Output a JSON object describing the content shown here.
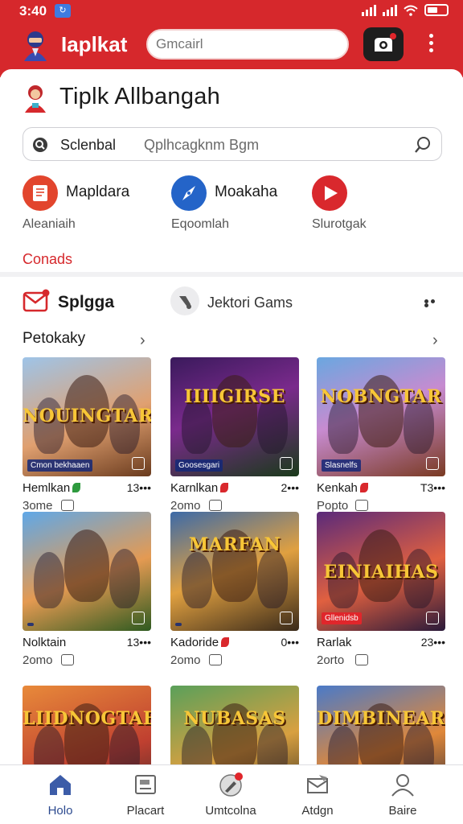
{
  "status_bar": {
    "time": "3:40",
    "notification_icon": "sync-icon"
  },
  "header": {
    "app_title": "Iaplkat",
    "search_placeholder": "Gmcairl",
    "colors": {
      "brand_red": "#d6282c"
    }
  },
  "section": {
    "title": "Tiplk Allbangah",
    "search": {
      "label": "Sclenbal",
      "placeholder": "Qplhcagknm Bgm"
    },
    "quick_actions": [
      {
        "title": "Mapldara",
        "subtitle": "Aleaniaih",
        "icon": "book-icon",
        "color": "#e2452d"
      },
      {
        "title": "Moakaha",
        "subtitle": "Eqoomlah",
        "icon": "compass-icon",
        "color": "#2464c8"
      },
      {
        "title": "",
        "subtitle": "Slurotgak",
        "icon": "play-icon",
        "color": "#d9282d"
      }
    ],
    "link_text": "Conads"
  },
  "games": {
    "tab1_label": "Splgga",
    "tab2_label": "Jektori Gams",
    "category_label": "Petokaky",
    "tiles": [
      {
        "art_title": "NOUINGTAR",
        "strip": "Cmon bekhaaen",
        "name": "Hemlkan",
        "badge_color": "#2e9a3e",
        "count": "13•••",
        "sub": "3ome",
        "bg": "linear-gradient(160deg,#9ec4e8 0%,#e0a070 55%,#6a3b1e 100%)"
      },
      {
        "art_title": "IIIIGIRSE",
        "strip": "Goosesgari",
        "name": "Karnlkan",
        "badge_color": "#d9282d",
        "count": "2•••",
        "sub": "2omo",
        "bg": "linear-gradient(160deg,#3a1a5c 0%,#7a2a8c 45%,#1a3a1a 100%)"
      },
      {
        "art_title": "NOBNGTAR",
        "strip": "Slasnelfs",
        "name": "Kenkah",
        "badge_color": "#d9282d",
        "count": "T3•••",
        "sub": "Popto",
        "bg": "linear-gradient(160deg,#6aa7e0 0%,#c78bd0 45%,#7a3a22 100%)"
      },
      {
        "art_title": "",
        "strip": "",
        "name": "Nolktain",
        "badge_color": "",
        "count": "13•••",
        "sub": "2omo",
        "bg": "linear-gradient(160deg,#5fa8e8 0%,#e49a52 55%,#2e5a20 100%)"
      },
      {
        "art_title": "MARFAN",
        "strip": "",
        "name": "Kadoride",
        "badge_color": "#d9282d",
        "count": "0•••",
        "sub": "2omo",
        "bg": "linear-gradient(160deg,#3c6aa8 0%,#e0a040 50%,#3a2a1a 100%)"
      },
      {
        "art_title": "EINIAIHAS",
        "strip": "Gllenidsb",
        "name": "Rarlak",
        "badge_color": "",
        "count": "23•••",
        "sub": "2orto",
        "bg": "linear-gradient(160deg,#5a2a7a 0%,#e06040 55%,#2a1a3a 100%)"
      },
      {
        "art_title": "LIIDNOGTAE",
        "strip": "",
        "name": "",
        "badge_color": "",
        "count": "",
        "sub": "",
        "bg": "linear-gradient(160deg,#e88a3a 0%,#c04030 60%,#4a2a2a 100%)"
      },
      {
        "art_title": "NUBASAS",
        "strip": "",
        "name": "",
        "badge_color": "",
        "count": "",
        "sub": "",
        "bg": "linear-gradient(160deg,#5aa05a 0%,#d8a040 55%,#3a3020 100%)"
      },
      {
        "art_title": "DIMBINEAR",
        "strip": "",
        "name": "",
        "badge_color": "",
        "count": "",
        "sub": "",
        "bg": "linear-gradient(160deg,#4a7ac8 0%,#e0883a 55%,#2a2a3a 100%)"
      }
    ]
  },
  "bottom_nav": [
    {
      "label": "Holo",
      "icon": "home-icon",
      "active": true
    },
    {
      "label": "Placart",
      "icon": "picture-icon",
      "active": false
    },
    {
      "label": "Umtcolna",
      "icon": "pen-badge-icon",
      "active": false
    },
    {
      "label": "Atdgn",
      "icon": "mail-icon",
      "active": false
    },
    {
      "label": "Baire",
      "icon": "profile-icon",
      "active": false
    }
  ]
}
